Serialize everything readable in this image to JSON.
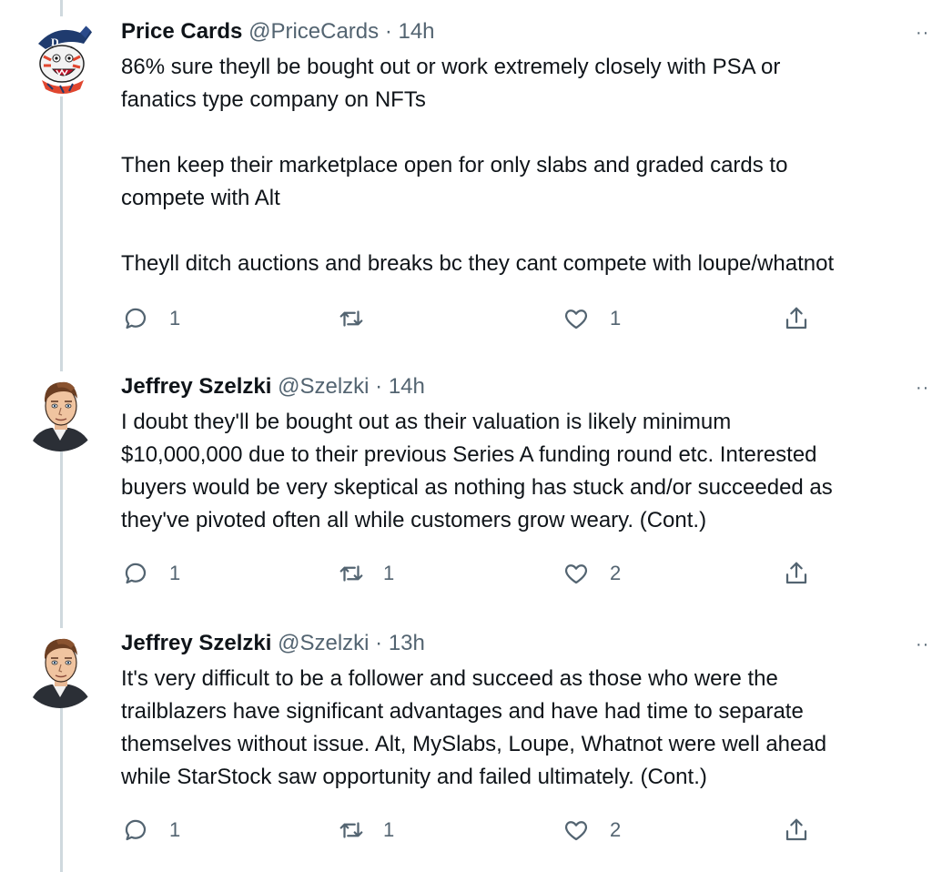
{
  "tweets": [
    {
      "name": "Price Cards",
      "handle": "@PriceCards",
      "separator": "·",
      "time": "14h",
      "more": "··",
      "lines": [
        "86% sure theyll be bought out or work extremely closely with PSA or",
        "fanatics type company on NFTs",
        "",
        "Then keep their marketplace open for only slabs and graded cards to",
        "compete with Alt",
        "",
        "Theyll ditch auctions and breaks bc they cant compete with loupe/whatnot"
      ],
      "reply_count": "1",
      "retweet_count": "",
      "like_count": "1"
    },
    {
      "name": "Jeffrey Szelzki",
      "handle": "@Szelzki",
      "separator": "·",
      "time": "14h",
      "more": "··",
      "lines": [
        "I doubt they'll be bought out as their valuation is likely minimum",
        "$10,000,000 due to their previous Series A funding round etc. Interested",
        "buyers would be very skeptical as nothing has stuck and/or succeeded as",
        "they've pivoted often all while customers grow weary. (Cont.)"
      ],
      "reply_count": "1",
      "retweet_count": "1",
      "like_count": "2"
    },
    {
      "name": "Jeffrey Szelzki",
      "handle": "@Szelzki",
      "separator": "·",
      "time": "13h",
      "more": "··",
      "lines": [
        "It's very difficult to be a follower and succeed as those who were the",
        "trailblazers have significant advantages and have had time to separate",
        "themselves without issue. Alt, MySlabs, Loupe, Whatnot were well ahead",
        "while StarStock saw opportunity and failed ultimately. (Cont.)"
      ],
      "reply_count": "1",
      "retweet_count": "1",
      "like_count": "2"
    }
  ],
  "icons": {
    "reply": "reply-icon",
    "retweet": "retweet-icon",
    "like": "heart-icon",
    "share": "share-icon",
    "more": "more-icon"
  },
  "colors": {
    "text": "#0f1419",
    "secondary": "#536471",
    "thread_line": "#cfd9de"
  }
}
